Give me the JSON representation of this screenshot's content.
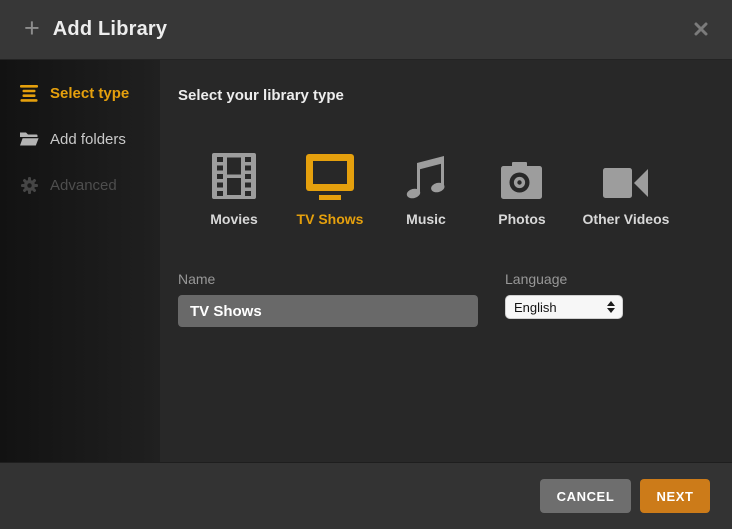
{
  "dialog": {
    "title": "Add Library"
  },
  "sidebar": {
    "items": [
      {
        "label": "Select type",
        "icon": "list-lines-icon",
        "state": "active"
      },
      {
        "label": "Add folders",
        "icon": "folder-icon",
        "state": "normal"
      },
      {
        "label": "Advanced",
        "icon": "gear-icon",
        "state": "disabled"
      }
    ]
  },
  "main": {
    "heading": "Select your library type",
    "library_types": [
      {
        "label": "Movies",
        "icon": "film-icon",
        "selected": false
      },
      {
        "label": "TV Shows",
        "icon": "tv-icon",
        "selected": true
      },
      {
        "label": "Music",
        "icon": "music-note-icon",
        "selected": false
      },
      {
        "label": "Photos",
        "icon": "camera-icon",
        "selected": false
      },
      {
        "label": "Other Videos",
        "icon": "video-camera-icon",
        "selected": false
      }
    ],
    "name_field": {
      "label": "Name",
      "value": "TV Shows"
    },
    "language_field": {
      "label": "Language",
      "value": "English"
    }
  },
  "footer": {
    "cancel_label": "CANCEL",
    "next_label": "NEXT"
  },
  "colors": {
    "accent_gold": "#e5a00d",
    "accent_orange": "#cc7b19",
    "icon_gray": "#9d9d9d"
  }
}
